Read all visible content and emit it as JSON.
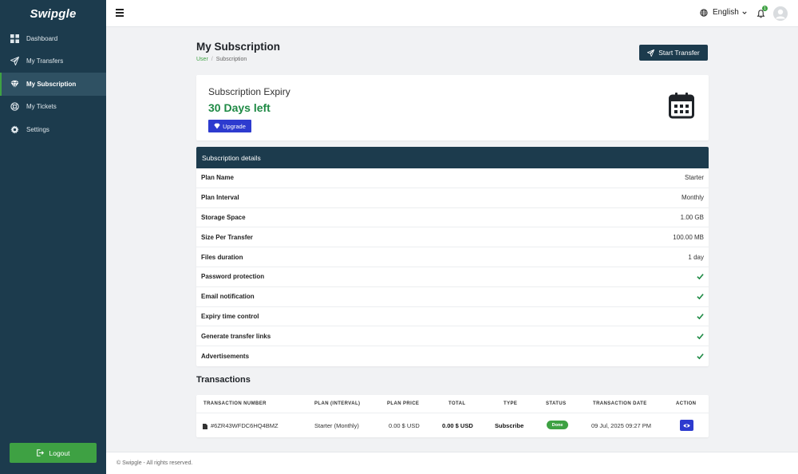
{
  "app": {
    "logo_text": "Swipgle"
  },
  "sidebar": {
    "items": [
      {
        "label": "Dashboard",
        "icon": "dashboard-icon",
        "active": false
      },
      {
        "label": "My Transfers",
        "icon": "paper-plane-icon",
        "active": false
      },
      {
        "label": "My Subscription",
        "icon": "diamond-icon",
        "active": true
      },
      {
        "label": "My Tickets",
        "icon": "lifebuoy-icon",
        "active": false
      },
      {
        "label": "Settings",
        "icon": "gear-icon",
        "active": false
      }
    ],
    "logout_label": "Logout"
  },
  "topbar": {
    "language": "English",
    "notification_count": "1"
  },
  "page": {
    "title": "My Subscription",
    "breadcrumb": {
      "parent": "User",
      "separator": "/",
      "current": "Subscription"
    },
    "start_transfer_label": "Start Transfer"
  },
  "expiry": {
    "label": "Subscription Expiry",
    "value": "30 Days left",
    "upgrade_label": "Upgrade"
  },
  "details": {
    "heading": "Subscription details",
    "rows": [
      {
        "key": "Plan Name",
        "value": "Starter"
      },
      {
        "key": "Plan Interval",
        "value": "Monthly"
      },
      {
        "key": "Storage Space",
        "value": "1.00 GB"
      },
      {
        "key": "Size Per Transfer",
        "value": "100.00 MB"
      },
      {
        "key": "Files duration",
        "value": "1 day"
      },
      {
        "key": "Password protection",
        "check": true
      },
      {
        "key": "Email notification",
        "check": true
      },
      {
        "key": "Expiry time control",
        "check": true
      },
      {
        "key": "Generate transfer links",
        "check": true
      },
      {
        "key": "Advertisements",
        "check": true
      }
    ]
  },
  "transactions": {
    "title": "Transactions",
    "columns": [
      "Transaction number",
      "Plan (interval)",
      "Plan price",
      "Total",
      "Type",
      "Status",
      "Transaction date",
      "Action"
    ],
    "rows": [
      {
        "number": "#6ZR43WFDC6HQ4BMZ",
        "plan": "Starter (Monthly)",
        "price": "0.00 $ USD",
        "total": "0.00 $ USD",
        "type": "Subscribe",
        "status": "Done",
        "date": "09 Jul, 2025 09:27 PM"
      }
    ]
  },
  "footer": {
    "text": "© Swipgle - All rights reserved."
  },
  "colors": {
    "sidebar": "#1c3b4d",
    "accent_green": "#3ea143",
    "primary_blue": "#2d3bcf",
    "expiry_green": "#1f8a45"
  }
}
